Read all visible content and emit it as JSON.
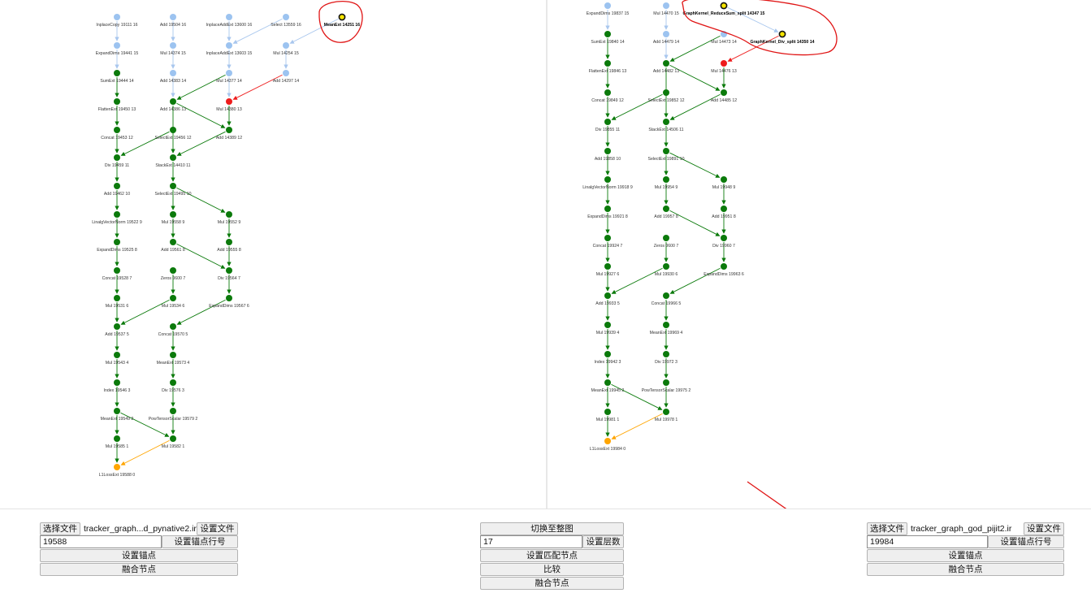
{
  "colors": {
    "done": "#0b7a0b",
    "pending": "#9cc3f0",
    "mismatch": "#ee1c1c",
    "root": "#ffa500",
    "highlight": "#f5e400",
    "annotation": "#e01515",
    "pending_edge": "#a9c7ee"
  },
  "left_graph": {
    "nodes": [
      {
        "id": "l1",
        "label": "InplaceCopy 19111 16",
        "status": "pending"
      },
      {
        "id": "l2",
        "label": "Add 19504 16",
        "status": "pending"
      },
      {
        "id": "l3",
        "label": "InplaceAddExt 13600 16",
        "status": "pending"
      },
      {
        "id": "l4",
        "label": "Select 13559 16",
        "status": "pending"
      },
      {
        "id": "l5",
        "label": "MeanExt 14251 16",
        "status": "highlight"
      },
      {
        "id": "l6",
        "label": "ExpandDims 19441 15",
        "status": "pending"
      },
      {
        "id": "l7",
        "label": "Mul 14374 15",
        "status": "pending"
      },
      {
        "id": "l8",
        "label": "InplaceAddExt 13603 15",
        "status": "pending"
      },
      {
        "id": "l9",
        "label": "Mul 14254 15",
        "status": "pending"
      },
      {
        "id": "l10",
        "label": "SumExt 19444 14",
        "status": "done"
      },
      {
        "id": "l11",
        "label": "Add 14383 14",
        "status": "pending"
      },
      {
        "id": "l12",
        "label": "Mul 14377 14",
        "status": "pending"
      },
      {
        "id": "l13",
        "label": "Add 14297 14",
        "status": "pending"
      },
      {
        "id": "l14",
        "label": "FlattenExt 19450 13",
        "status": "done"
      },
      {
        "id": "l15",
        "label": "Add 14386 13",
        "status": "done"
      },
      {
        "id": "l16",
        "label": "Mul 14380 13",
        "status": "mismatch"
      },
      {
        "id": "l17",
        "label": "Concat 19453 12",
        "status": "done"
      },
      {
        "id": "l18",
        "label": "SelectExt 19456 12",
        "status": "done"
      },
      {
        "id": "l19",
        "label": "Add 14389 12",
        "status": "done"
      },
      {
        "id": "l20",
        "label": "Div 19459 11",
        "status": "done"
      },
      {
        "id": "l21",
        "label": "StackExt 14410 11",
        "status": "done"
      },
      {
        "id": "l22",
        "label": "Add 19462 10",
        "status": "done"
      },
      {
        "id": "l23",
        "label": "SelectExt 19495 10",
        "status": "done"
      },
      {
        "id": "l24",
        "label": "LinalgVectorNorm 19522 9",
        "status": "done"
      },
      {
        "id": "l25",
        "label": "Mul 19558 9",
        "status": "done"
      },
      {
        "id": "l26",
        "label": "Mul 19552 9",
        "status": "done"
      },
      {
        "id": "l27",
        "label": "ExpandDims 19525 8",
        "status": "done"
      },
      {
        "id": "l28",
        "label": "Add 19561 8",
        "status": "done"
      },
      {
        "id": "l29",
        "label": "Add 19555 8",
        "status": "done"
      },
      {
        "id": "l30",
        "label": "Concat 19528 7",
        "status": "done"
      },
      {
        "id": "l31",
        "label": "Zeros 0600 7",
        "status": "done"
      },
      {
        "id": "l32",
        "label": "Div 19564 7",
        "status": "done"
      },
      {
        "id": "l33",
        "label": "Mul 19531 6",
        "status": "done"
      },
      {
        "id": "l34",
        "label": "Mul 19534 6",
        "status": "done"
      },
      {
        "id": "l35",
        "label": "ExpandDims 19567 6",
        "status": "done"
      },
      {
        "id": "l36",
        "label": "Add 19537 5",
        "status": "done"
      },
      {
        "id": "l37",
        "label": "Concat 19570 5",
        "status": "done"
      },
      {
        "id": "l38",
        "label": "Mul 19543 4",
        "status": "done"
      },
      {
        "id": "l39",
        "label": "MeanExt 19573 4",
        "status": "done"
      },
      {
        "id": "l40",
        "label": "Index 19546 3",
        "status": "done"
      },
      {
        "id": "l41",
        "label": "Div 19576 3",
        "status": "done"
      },
      {
        "id": "l42",
        "label": "MeanExt 19549 2",
        "status": "done"
      },
      {
        "id": "l43",
        "label": "PowTensorScalar 19579 2",
        "status": "done"
      },
      {
        "id": "l44",
        "label": "Mul 19585 1",
        "status": "done"
      },
      {
        "id": "l45",
        "label": "Mul 19582 1",
        "status": "done"
      },
      {
        "id": "l46",
        "label": "L1LossExt 19588 0",
        "status": "root"
      }
    ],
    "edges": [
      [
        "l1",
        "l6",
        "pending"
      ],
      [
        "l6",
        "l10",
        "pending"
      ],
      [
        "l10",
        "l14",
        "done"
      ],
      [
        "l14",
        "l17",
        "done"
      ],
      [
        "l17",
        "l20",
        "done"
      ],
      [
        "l2",
        "l7",
        "pending"
      ],
      [
        "l7",
        "l11",
        "pending"
      ],
      [
        "l11",
        "l15",
        "pending"
      ],
      [
        "l15",
        "l21",
        "done"
      ],
      [
        "l15",
        "l19",
        "done"
      ],
      [
        "l3",
        "l8",
        "pending"
      ],
      [
        "l4",
        "l8",
        "pending"
      ],
      [
        "l5",
        "l9",
        "pending"
      ],
      [
        "l8",
        "l12",
        "pending"
      ],
      [
        "l9",
        "l13",
        "pending"
      ],
      [
        "l12",
        "l15",
        "done"
      ],
      [
        "l12",
        "l16",
        "pending"
      ],
      [
        "l13",
        "l16",
        "mismatch"
      ],
      [
        "l16",
        "l19",
        "done"
      ],
      [
        "l19",
        "l21",
        "done"
      ],
      [
        "l18",
        "l20",
        "done"
      ],
      [
        "l20",
        "l22",
        "done"
      ],
      [
        "l21",
        "l23",
        "done"
      ],
      [
        "l22",
        "l24",
        "done"
      ],
      [
        "l23",
        "l25",
        "done"
      ],
      [
        "l23",
        "l26",
        "done"
      ],
      [
        "l24",
        "l27",
        "done"
      ],
      [
        "l25",
        "l28",
        "done"
      ],
      [
        "l26",
        "l29",
        "done"
      ],
      [
        "l27",
        "l30",
        "done"
      ],
      [
        "l28",
        "l32",
        "done"
      ],
      [
        "l29",
        "l32",
        "done"
      ],
      [
        "l30",
        "l33",
        "done"
      ],
      [
        "l31",
        "l34",
        "done"
      ],
      [
        "l32",
        "l35",
        "done"
      ],
      [
        "l33",
        "l36",
        "done"
      ],
      [
        "l34",
        "l36",
        "done"
      ],
      [
        "l35",
        "l37",
        "done"
      ],
      [
        "l36",
        "l38",
        "done"
      ],
      [
        "l37",
        "l39",
        "done"
      ],
      [
        "l38",
        "l40",
        "done"
      ],
      [
        "l39",
        "l41",
        "done"
      ],
      [
        "l40",
        "l42",
        "done"
      ],
      [
        "l41",
        "l43",
        "done"
      ],
      [
        "l42",
        "l44",
        "done"
      ],
      [
        "l42",
        "l45",
        "done"
      ],
      [
        "l43",
        "l45",
        "done"
      ],
      [
        "l44",
        "l46",
        "done"
      ],
      [
        "l45",
        "l46",
        "root"
      ]
    ]
  },
  "right_graph": {
    "nodes": [
      {
        "id": "r1",
        "label": "ExpandDims 19837 15",
        "status": "pending"
      },
      {
        "id": "r2",
        "label": "Mul 14470 15",
        "status": "pending"
      },
      {
        "id": "r3",
        "label": "GraphKernel_ReduceSum_split 14347 15",
        "status": "highlight"
      },
      {
        "id": "r4",
        "label": "SumExt 19840 14",
        "status": "done"
      },
      {
        "id": "r5",
        "label": "Add 14479 14",
        "status": "pending"
      },
      {
        "id": "r6",
        "label": "Mul 14473 14",
        "status": "pending"
      },
      {
        "id": "r7",
        "label": "GraphKernel_Div_split 14350 14",
        "status": "highlight"
      },
      {
        "id": "r8",
        "label": "FlattenExt 19846 13",
        "status": "done"
      },
      {
        "id": "r9",
        "label": "Add 14482 13",
        "status": "done"
      },
      {
        "id": "r10",
        "label": "Mul 14476 13",
        "status": "mismatch"
      },
      {
        "id": "r11",
        "label": "Concat 19849 12",
        "status": "done"
      },
      {
        "id": "r12",
        "label": "SelectExt 19852 12",
        "status": "done"
      },
      {
        "id": "r13",
        "label": "Add 14485 12",
        "status": "done"
      },
      {
        "id": "r14",
        "label": "Div 19855 11",
        "status": "done"
      },
      {
        "id": "r15",
        "label": "StackExt 14506 11",
        "status": "done"
      },
      {
        "id": "r16",
        "label": "Add 19858 10",
        "status": "done"
      },
      {
        "id": "r17",
        "label": "SelectExt 19891 10",
        "status": "done"
      },
      {
        "id": "r18",
        "label": "LinalgVectorNorm 19918 9",
        "status": "done"
      },
      {
        "id": "r19",
        "label": "Mul 19954 9",
        "status": "done"
      },
      {
        "id": "r20",
        "label": "Mul 19948 9",
        "status": "done"
      },
      {
        "id": "r21",
        "label": "ExpandDims 19921 8",
        "status": "done"
      },
      {
        "id": "r22",
        "label": "Add 19957 8",
        "status": "done"
      },
      {
        "id": "r23",
        "label": "Add 19951 8",
        "status": "done"
      },
      {
        "id": "r24",
        "label": "Concat 19924 7",
        "status": "done"
      },
      {
        "id": "r25",
        "label": "Zeros 0600 7",
        "status": "done"
      },
      {
        "id": "r26",
        "label": "Div 19960 7",
        "status": "done"
      },
      {
        "id": "r27",
        "label": "Mul 19927 6",
        "status": "done"
      },
      {
        "id": "r28",
        "label": "Mul 19930 6",
        "status": "done"
      },
      {
        "id": "r29",
        "label": "ExpandDims 19963 6",
        "status": "done"
      },
      {
        "id": "r30",
        "label": "Add 19933 5",
        "status": "done"
      },
      {
        "id": "r31",
        "label": "Concat 19966 5",
        "status": "done"
      },
      {
        "id": "r32",
        "label": "Mul 19939 4",
        "status": "done"
      },
      {
        "id": "r33",
        "label": "MeanExt 19969 4",
        "status": "done"
      },
      {
        "id": "r34",
        "label": "Index 19942 3",
        "status": "done"
      },
      {
        "id": "r35",
        "label": "Div 19972 3",
        "status": "done"
      },
      {
        "id": "r36",
        "label": "MeanExt 19945 2",
        "status": "done"
      },
      {
        "id": "r37",
        "label": "PowTensorScalar 19975 2",
        "status": "done"
      },
      {
        "id": "r38",
        "label": "Mul 19981 1",
        "status": "done"
      },
      {
        "id": "r39",
        "label": "Mul 19978 1",
        "status": "done"
      },
      {
        "id": "r40",
        "label": "L1LossExt 19984 0",
        "status": "root"
      }
    ],
    "edges": [
      [
        "r1",
        "r4",
        "pending"
      ],
      [
        "r4",
        "r8",
        "done"
      ],
      [
        "r8",
        "r11",
        "done"
      ],
      [
        "r11",
        "r14",
        "done"
      ],
      [
        "r2",
        "r5",
        "pending"
      ],
      [
        "r5",
        "r9",
        "pending"
      ],
      [
        "r6",
        "r9",
        "done"
      ],
      [
        "r3",
        "r7",
        "pending"
      ],
      [
        "r7",
        "r10",
        "mismatch"
      ],
      [
        "r9",
        "r13",
        "done"
      ],
      [
        "r9",
        "r15",
        "done"
      ],
      [
        "r10",
        "r13",
        "done"
      ],
      [
        "r12",
        "r14",
        "done"
      ],
      [
        "r13",
        "r15",
        "done"
      ],
      [
        "r14",
        "r16",
        "done"
      ],
      [
        "r15",
        "r17",
        "done"
      ],
      [
        "r16",
        "r18",
        "done"
      ],
      [
        "r17",
        "r19",
        "done"
      ],
      [
        "r17",
        "r20",
        "done"
      ],
      [
        "r18",
        "r21",
        "done"
      ],
      [
        "r19",
        "r22",
        "done"
      ],
      [
        "r20",
        "r23",
        "done"
      ],
      [
        "r21",
        "r24",
        "done"
      ],
      [
        "r22",
        "r26",
        "done"
      ],
      [
        "r23",
        "r26",
        "done"
      ],
      [
        "r24",
        "r27",
        "done"
      ],
      [
        "r25",
        "r28",
        "done"
      ],
      [
        "r26",
        "r29",
        "done"
      ],
      [
        "r27",
        "r30",
        "done"
      ],
      [
        "r28",
        "r30",
        "done"
      ],
      [
        "r29",
        "r31",
        "done"
      ],
      [
        "r30",
        "r32",
        "done"
      ],
      [
        "r31",
        "r33",
        "done"
      ],
      [
        "r32",
        "r34",
        "done"
      ],
      [
        "r33",
        "r35",
        "done"
      ],
      [
        "r34",
        "r36",
        "done"
      ],
      [
        "r35",
        "r37",
        "done"
      ],
      [
        "r36",
        "r38",
        "done"
      ],
      [
        "r36",
        "r39",
        "done"
      ],
      [
        "r37",
        "r39",
        "done"
      ],
      [
        "r38",
        "r40",
        "done"
      ],
      [
        "r39",
        "r40",
        "root"
      ]
    ]
  },
  "left_panel": {
    "choose_file_label": "选择文件",
    "file_name": "tracker_graph...d_pynative2.ir",
    "set_file_label": "设置文件",
    "anchor_line_value": "19588",
    "set_anchor_line_label": "设置锚点行号",
    "set_anchor_label": "设置锚点",
    "merge_nodes_label": "融合节点"
  },
  "center_panel": {
    "switch_full_graph_label": "切换至整图",
    "depth_value": "17",
    "set_depth_label": "设置层数",
    "set_match_nodes_label": "设置匹配节点",
    "compare_label": "比较",
    "merge_nodes_label": "融合节点"
  },
  "right_panel": {
    "choose_file_label": "选择文件",
    "file_name": "tracker_graph_god_pijit2.ir",
    "set_file_label": "设置文件",
    "anchor_line_value": "19984",
    "set_anchor_line_label": "设置锚点行号",
    "set_anchor_label": "设置锚点",
    "merge_nodes_label": "融合节点"
  }
}
